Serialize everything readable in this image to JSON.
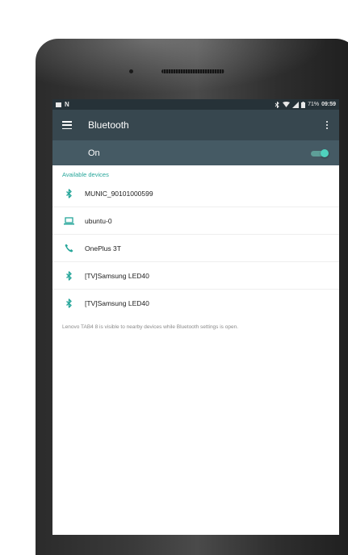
{
  "status_bar": {
    "battery": "71%",
    "time": "09:59",
    "carrier_icon": "N"
  },
  "toolbar": {
    "title": "Bluetooth"
  },
  "bluetooth_switch": {
    "label": "On",
    "enabled": true
  },
  "available_devices": {
    "header": "Available devices",
    "items": [
      {
        "name": "MUNIC_90101000599",
        "icon": "bluetooth-icon"
      },
      {
        "name": "ubuntu-0",
        "icon": "laptop-icon"
      },
      {
        "name": "OnePlus 3T",
        "icon": "phone-icon"
      },
      {
        "name": "[TV]Samsung LED40",
        "icon": "bluetooth-icon"
      },
      {
        "name": "[TV]Samsung LED40",
        "icon": "bluetooth-icon"
      }
    ]
  },
  "visibility_note": "Lenovo TAB4 8 is visible to nearby devices while Bluetooth settings is open.",
  "colors": {
    "accent": "#26a69a",
    "toolbar": "#37474f",
    "switch_bar": "#455a64",
    "status_bar": "#263238"
  }
}
